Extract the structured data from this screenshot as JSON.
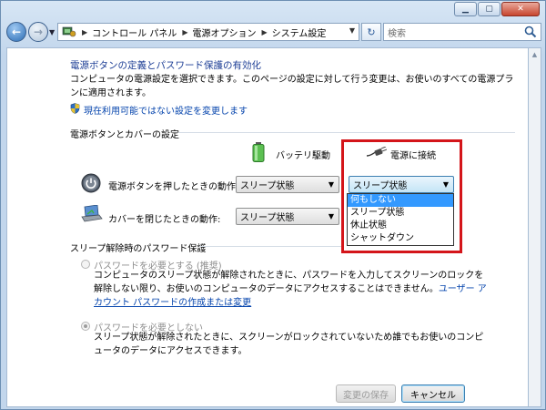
{
  "navigation": {
    "breadcrumbs": [
      "コントロール パネル",
      "電源オプション",
      "システム設定"
    ],
    "search_placeholder": "検索"
  },
  "main": {
    "page_title": "電源ボタンの定義とパスワード保護の有効化",
    "description_line1": "コンピュータの電源設定を選択できます。このページの設定に対して行う変更は、お使いのすべての電源プラ",
    "description_line2": "ンに適用されます。",
    "change_settings_link": "現在利用可能ではない設定を変更します",
    "section_power_buttons": "電源ボタンとカバーの設定",
    "col_battery": "バッテリ駆動",
    "col_plugged": "電源に接続",
    "power_button_label": "電源ボタンを押したときの動作:",
    "power_battery_value": "スリープ状態",
    "power_plugged_value": "スリープ状態",
    "lid_label": "カバーを閉じたときの動作:",
    "lid_battery_value": "スリープ状態",
    "dropdown_options": [
      "何もしない",
      "スリープ状態",
      "休止状態",
      "シャットダウン"
    ],
    "section_password": "スリープ解除時のパスワード保護",
    "require_password_label": "パスワードを必要とする (推奨)",
    "require_desc_line1": "コンピュータのスリープ状態が解除されたときに、パスワードを入力してスクリーンのロックを",
    "require_desc_line2": "解除しない限り、お使いのコンピュータのデータにアクセスすることはできません。",
    "require_desc_link_part1": "ユーザー ア",
    "require_desc_link_part2": "カウント パスワードの作成または変更",
    "no_password_label": "パスワードを必要としない",
    "no_desc_line1": "スリープ状態が解除されたときに、スクリーンがロックされていないため誰でもお使いのコンピ",
    "no_desc_line2": "ュータのデータにアクセスできます。",
    "save_button": "変更の保存",
    "cancel_button": "キャンセル"
  },
  "colors": {
    "highlight_border": "#d4151a",
    "link": "#0645ad",
    "title_blue": "#1e3f96",
    "selection": "#3399ff"
  }
}
